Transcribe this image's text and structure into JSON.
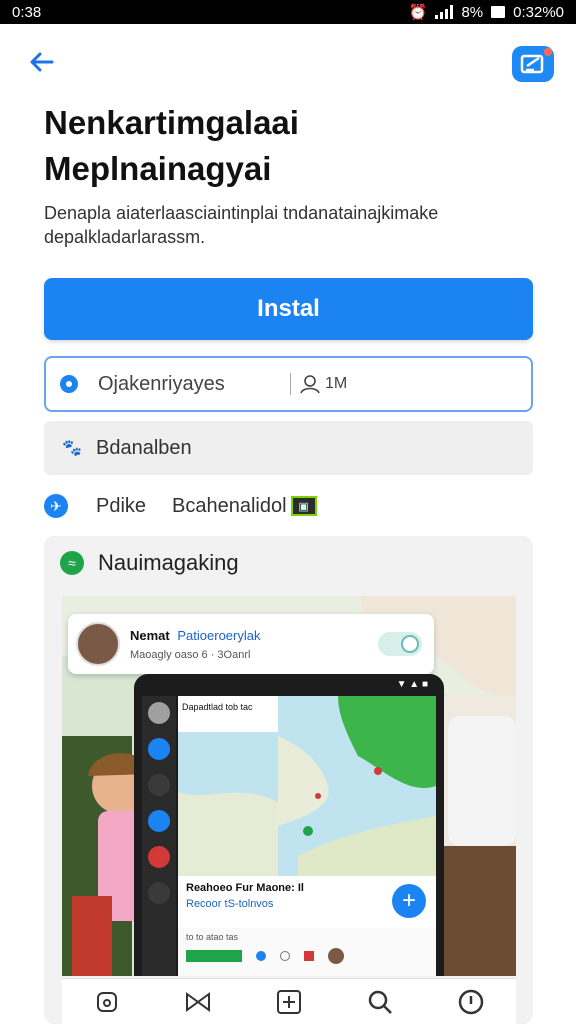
{
  "status": {
    "time": "0:38",
    "battery_percent": "8%",
    "right_text": "0:32%0"
  },
  "header": {
    "back_icon": "arrow-left-icon",
    "action_icon": "edit-note-icon"
  },
  "title_lines": [
    "Nenkartimgalaai",
    "Meplnainagyai"
  ],
  "description": "Denapla aiaterlaasciaintinplai tndanatainajkimake depalkladarlarassm.",
  "install_label": "Instal",
  "search": {
    "value": "Ojakenriyayes",
    "aux_text": "1M"
  },
  "option_row": {
    "label": "Bdanalben"
  },
  "info_row": {
    "primary": "Pdike",
    "secondary": "Bcahenalidol"
  },
  "card": {
    "heading": "Nauimagaking",
    "notification": {
      "name": "Nemat",
      "title": "Patioeroerylak",
      "subtitle": "Maoagly oaso 6 · 3Oanrl"
    },
    "phone_header": "Dapadtlad tob tac",
    "phone_bottom": {
      "title": "Reahoeo Fur Maone: Il",
      "subtitle": "Recoor tS-tolnvos"
    },
    "phone_footer": "to to atao tas"
  },
  "colors": {
    "accent": "#1c83f2",
    "green": "#1fa44a"
  }
}
